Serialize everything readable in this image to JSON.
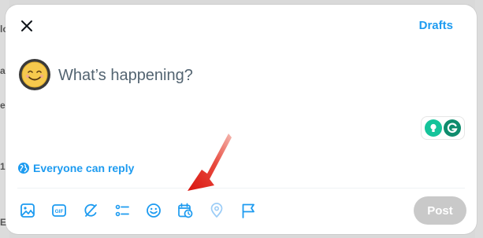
{
  "background": {
    "left_fragments": [
      "lo",
      "a",
      "e",
      "1",
      "",
      "E"
    ]
  },
  "composer": {
    "close_icon": "close-icon",
    "drafts_label": "Drafts",
    "placeholder": "What’s happening?",
    "reply_setting_label": "Everyone can reply",
    "post_label": "Post",
    "toolbar_icons": [
      "media-icon",
      "gif-icon",
      "grok-icon",
      "poll-icon",
      "emoji-icon",
      "schedule-icon",
      "location-icon",
      "flag-icon"
    ]
  },
  "grammarly": {
    "icons": [
      "lightbulb-icon",
      "grammarly-g-icon"
    ]
  },
  "annotation": {
    "arrow_color": "#e0201c",
    "points_to": "schedule-icon"
  },
  "colors": {
    "accent": "#1d9bf0",
    "post_disabled": "#c9c9c9"
  }
}
